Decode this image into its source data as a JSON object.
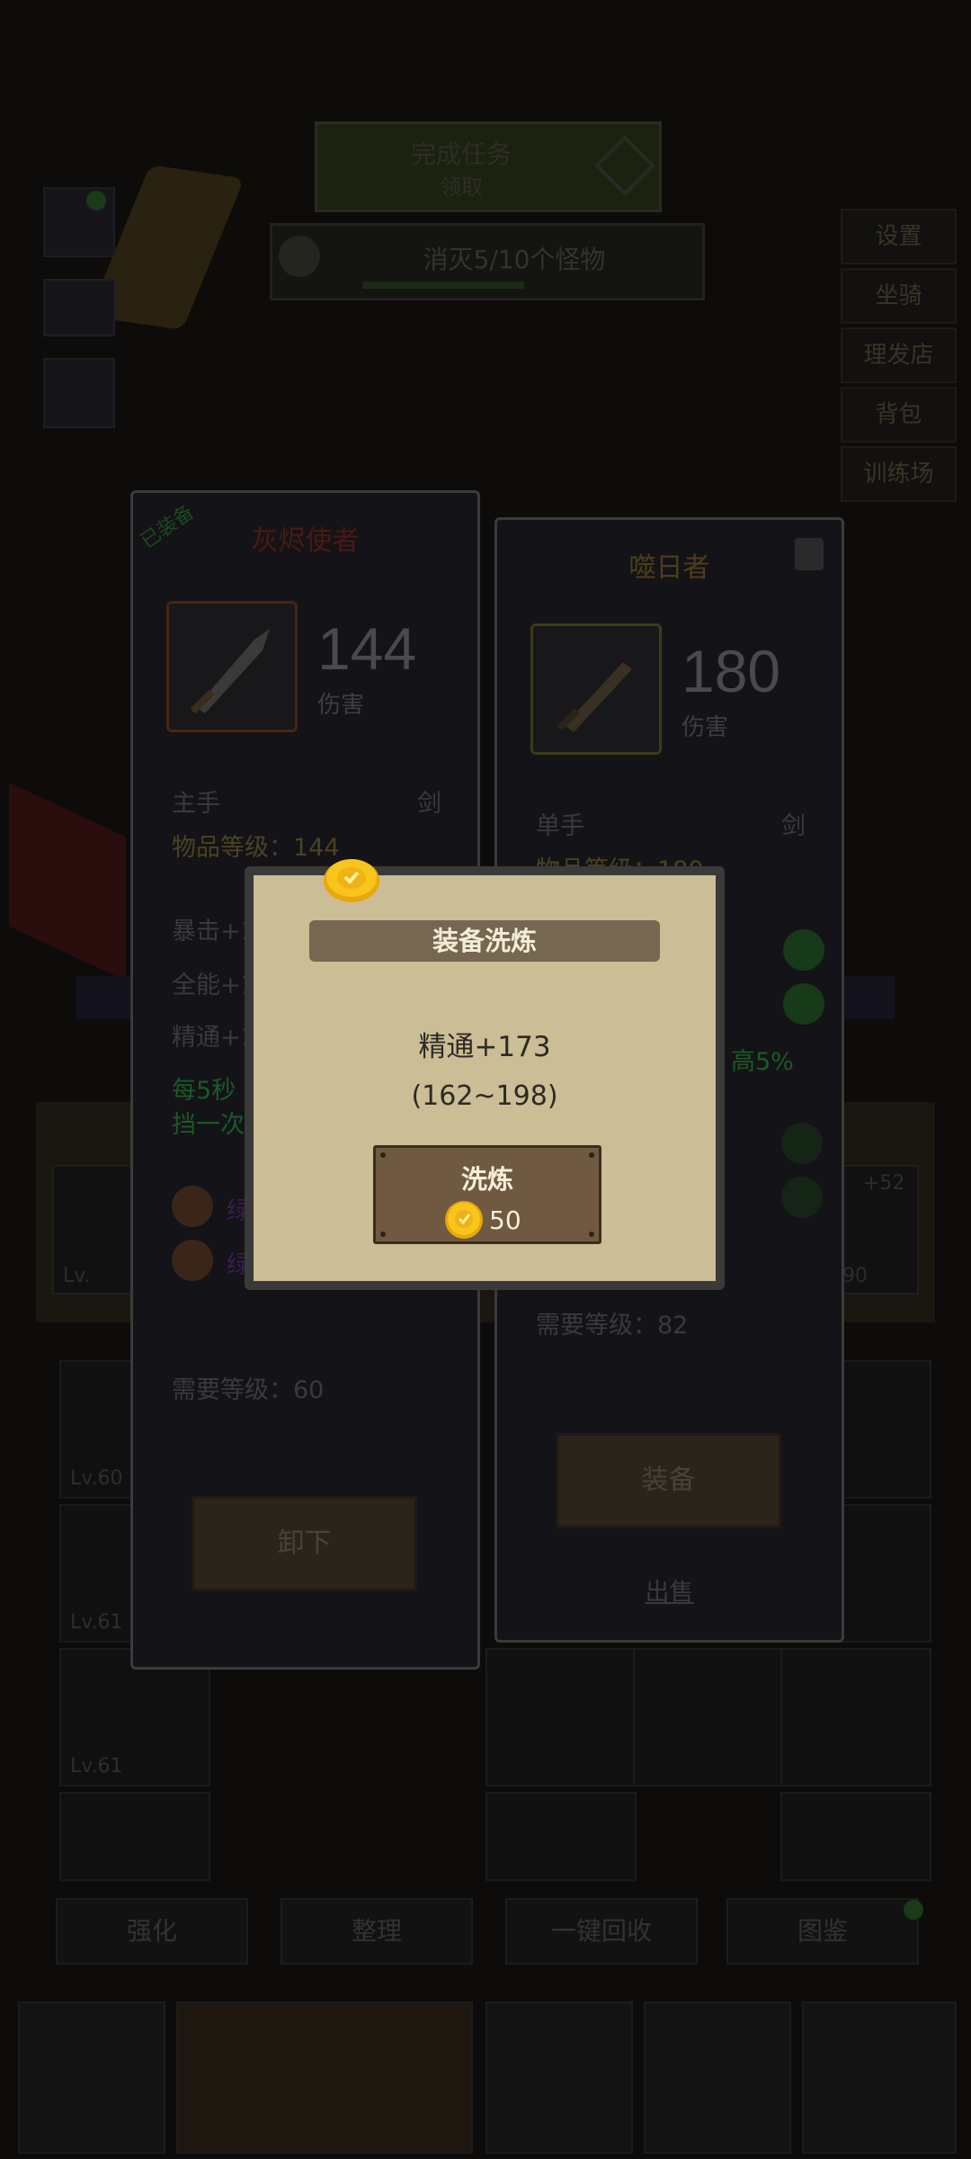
{
  "background": {
    "banner_line1": "完成任务",
    "banner_line2": "领取",
    "quest_text": "消灭5/10个怪物",
    "side_menu": [
      "设置",
      "坐骑",
      "理发店",
      "背包",
      "训练场"
    ],
    "slot_levels": [
      "Lv.60",
      "Lv.61",
      "Lv.61"
    ],
    "slot_left_level": "Lv.",
    "slot_right_level": ".90",
    "slot_right_plus": "+52",
    "tabs": [
      "强化",
      "整理",
      "一键回收",
      "图鉴"
    ]
  },
  "equipped_panel": {
    "tag": "已装备",
    "name": "灰烬使者",
    "damage": "144",
    "damage_label": "伤害",
    "slot": "主手",
    "weapon_type": "剑",
    "item_level": "物品等级：144",
    "stat1": "暴击+1",
    "stat2": "全能+1",
    "stat3": "精通+1",
    "effect_line1": "每5秒",
    "effect_line2": "挡一次",
    "gem1": "绿",
    "gem2": "绿",
    "required_level": "需要等级：60",
    "unequip_button": "卸下"
  },
  "compare_panel": {
    "name": "噬日者",
    "damage": "180",
    "damage_label": "伤害",
    "slot": "单手",
    "weapon_type": "剑",
    "item_level": "物品等级：180",
    "effect_text": "高5%",
    "required_level": "需要等级：82",
    "equip_button": "装备",
    "sell_link": "出售"
  },
  "dialog": {
    "title": "装备洗炼",
    "stat": "精通+173",
    "range": "(162~198)",
    "refine_button": "洗炼",
    "cost": "50"
  },
  "colors": {
    "dialog_bg": "#cbbd95",
    "dialog_title_bg": "#756750",
    "button_wood": "#6f5a41",
    "coin_gold": "#f2c318"
  }
}
